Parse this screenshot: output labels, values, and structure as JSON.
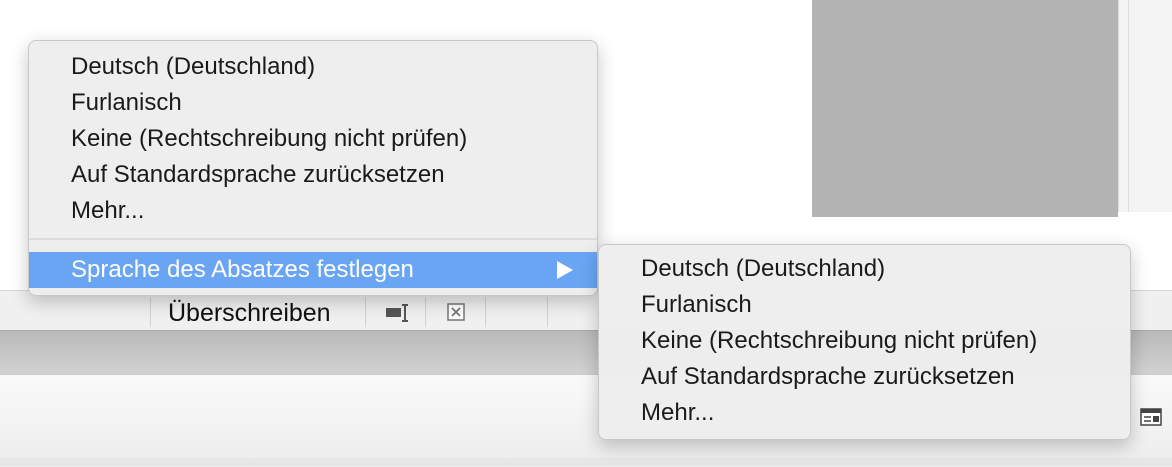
{
  "statusbar": {
    "mode_label": "Überschreiben"
  },
  "menu_main": {
    "items": [
      {
        "label": "Deutsch (Deutschland)"
      },
      {
        "label": "Furlanisch"
      },
      {
        "label": "Keine (Rechtschreibung nicht prüfen)"
      },
      {
        "label": "Auf Standardsprache zurücksetzen"
      },
      {
        "label": "Mehr..."
      }
    ],
    "submenu_trigger": {
      "label": "Sprache des Absatzes festlegen"
    }
  },
  "menu_sub": {
    "items": [
      {
        "label": "Deutsch (Deutschland)"
      },
      {
        "label": "Furlanisch"
      },
      {
        "label": "Keine (Rechtschreibung nicht prüfen)"
      },
      {
        "label": "Auf Standardsprache zurücksetzen"
      },
      {
        "label": "Mehr..."
      }
    ]
  },
  "colors": {
    "highlight": "#6aa5f4",
    "menu_bg": "#eeeeee",
    "gray_block": "#b3b3b3"
  }
}
